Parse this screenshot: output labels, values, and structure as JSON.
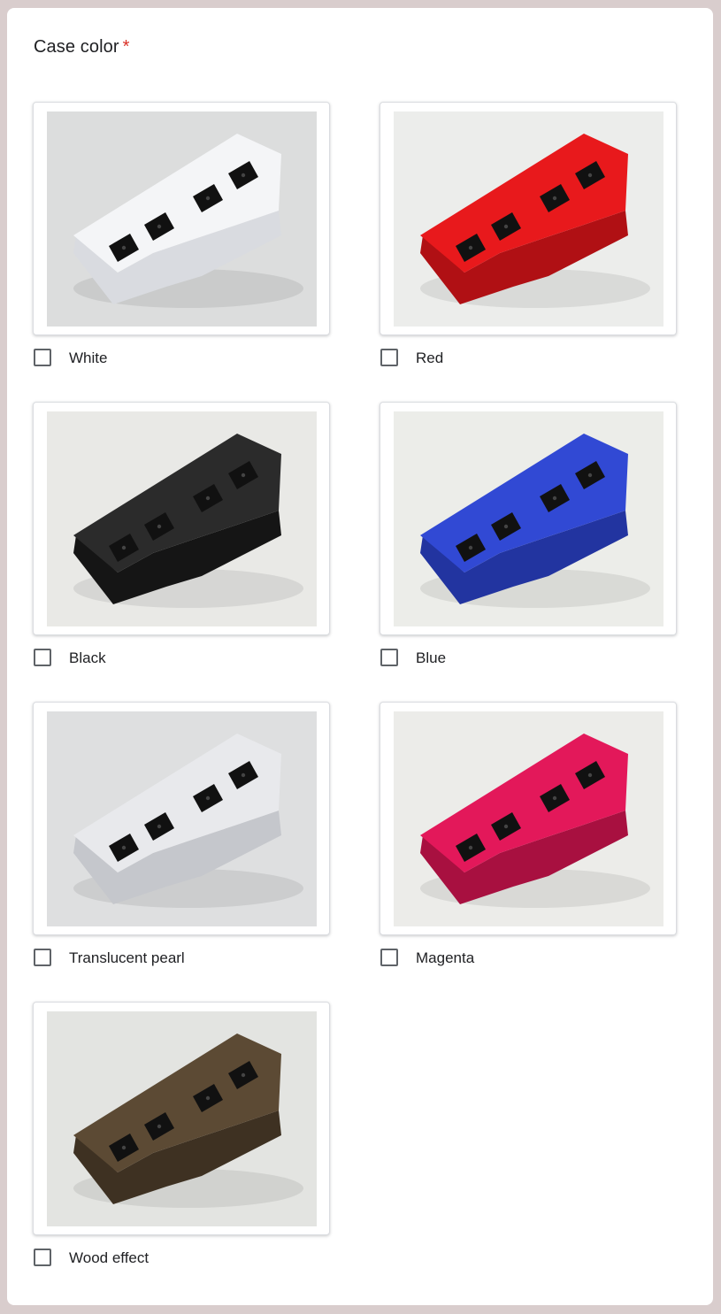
{
  "question": {
    "title": "Case color",
    "required_mark": "*"
  },
  "options": [
    {
      "label": "White",
      "case_color": "#f4f5f7",
      "shade_color": "#d9dbe0",
      "bg_color": "#dcdddd"
    },
    {
      "label": "Red",
      "case_color": "#e8191c",
      "shade_color": "#b01014",
      "bg_color": "#ecedeb"
    },
    {
      "label": "Black",
      "case_color": "#2b2b2b",
      "shade_color": "#151515",
      "bg_color": "#e9e9e6"
    },
    {
      "label": "Blue",
      "case_color": "#3149d4",
      "shade_color": "#2234a0",
      "bg_color": "#ecede9"
    },
    {
      "label": "Translucent pearl",
      "case_color": "#e8e9ec",
      "shade_color": "#c5c7cc",
      "bg_color": "#dedfe0"
    },
    {
      "label": "Magenta",
      "case_color": "#e3185a",
      "shade_color": "#a81040",
      "bg_color": "#ecece9"
    },
    {
      "label": "Wood effect",
      "case_color": "#5c4a34",
      "shade_color": "#3e3122",
      "bg_color": "#e3e4e1"
    }
  ]
}
